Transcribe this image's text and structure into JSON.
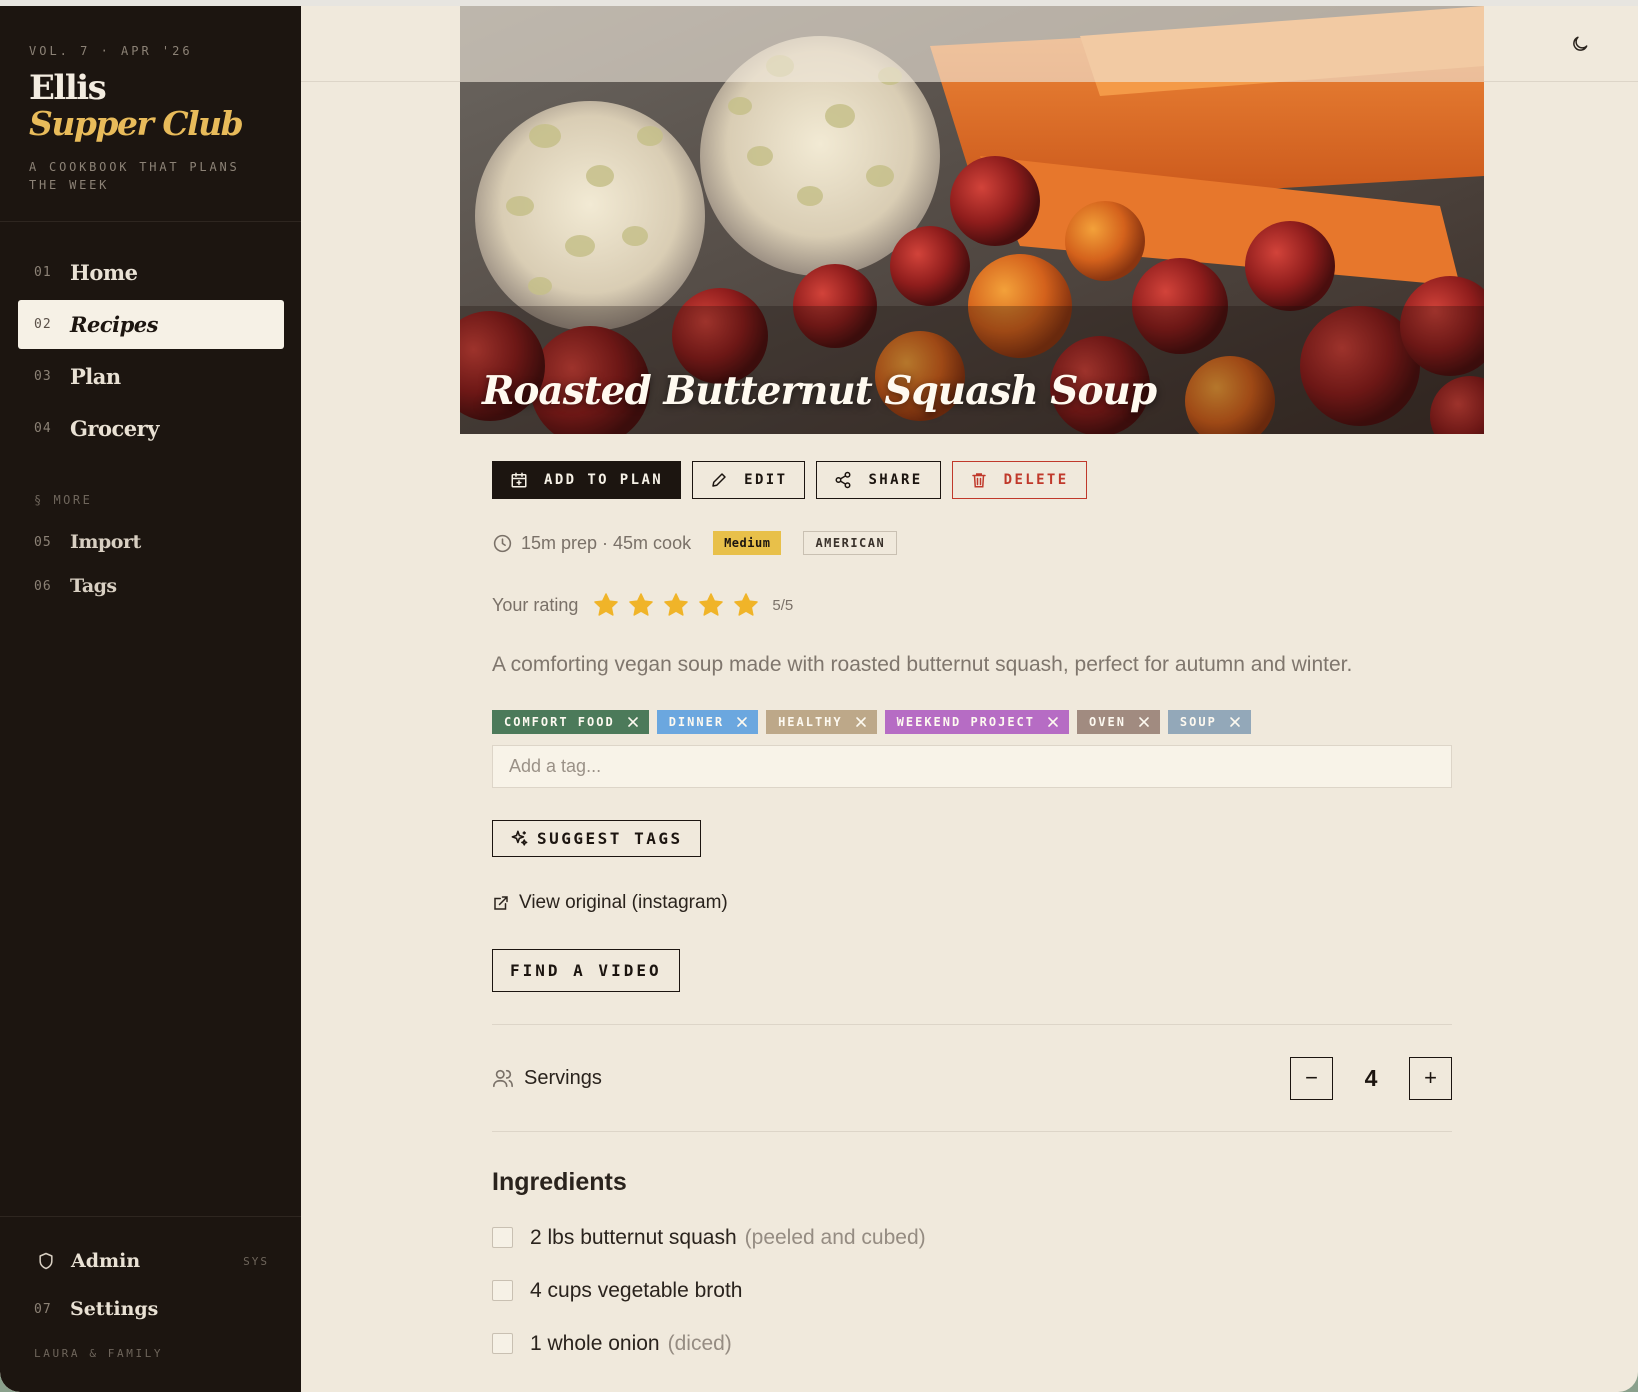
{
  "brand": {
    "volume": "VOL. 7 · APR '26",
    "name_line1": "Ellis",
    "name_line2": "Supper Club",
    "tagline": "A COOKBOOK THAT PLANS THE WEEK"
  },
  "nav": {
    "items": [
      {
        "num": "01",
        "label": "Home"
      },
      {
        "num": "02",
        "label": "Recipes",
        "active": true
      },
      {
        "num": "03",
        "label": "Plan"
      },
      {
        "num": "04",
        "label": "Grocery"
      }
    ],
    "more_label": "§ MORE",
    "more_items": [
      {
        "num": "05",
        "label": "Import"
      },
      {
        "num": "06",
        "label": "Tags"
      }
    ],
    "admin": {
      "label": "Admin",
      "badge": "SYS"
    },
    "settings": {
      "num": "07",
      "label": "Settings"
    },
    "household": "LAURA & FAMILY"
  },
  "header": {
    "theme_icon": "moon-icon"
  },
  "recipe": {
    "title": "Roasted Butternut Squash Soup",
    "actions": {
      "add_to_plan": "ADD TO PLAN",
      "edit": "EDIT",
      "share": "SHARE",
      "delete": "DELETE"
    },
    "time": "15m prep · 45m cook",
    "difficulty": "Medium",
    "cuisine": "AMERICAN",
    "rating_label": "Your rating",
    "rating": 5,
    "rating_max": 5,
    "rating_text": "5/5",
    "description": "A comforting vegan soup made with roasted butternut squash, perfect for autumn and winter.",
    "tags": [
      {
        "label": "COMFORT FOOD",
        "color": "#4c7a5a"
      },
      {
        "label": "DINNER",
        "color": "#6ba7df"
      },
      {
        "label": "HEALTHY",
        "color": "#bda889"
      },
      {
        "label": "WEEKEND PROJECT",
        "color": "#b66cc4"
      },
      {
        "label": "OVEN",
        "color": "#a18b80"
      },
      {
        "label": "SOUP",
        "color": "#93a8b9"
      }
    ],
    "tag_placeholder": "Add a tag...",
    "suggest_tags": "SUGGEST TAGS",
    "view_original": "View original (instagram)",
    "find_video": "FIND A VIDEO",
    "servings_label": "Servings",
    "servings": "4",
    "decrement": "−",
    "increment": "+",
    "ingredients_heading": "Ingredients",
    "ingredients": [
      {
        "text": "2 lbs butternut squash",
        "note": "(peeled and cubed)"
      },
      {
        "text": "4 cups vegetable broth",
        "note": ""
      },
      {
        "text": "1 whole onion",
        "note": "(diced)"
      }
    ]
  },
  "colors": {
    "sidebar_bg": "#1c1510",
    "page_bg": "#f0e9dc",
    "accent_gold": "#e8bb5a",
    "danger": "#c0392b",
    "star": "#f0b429"
  }
}
